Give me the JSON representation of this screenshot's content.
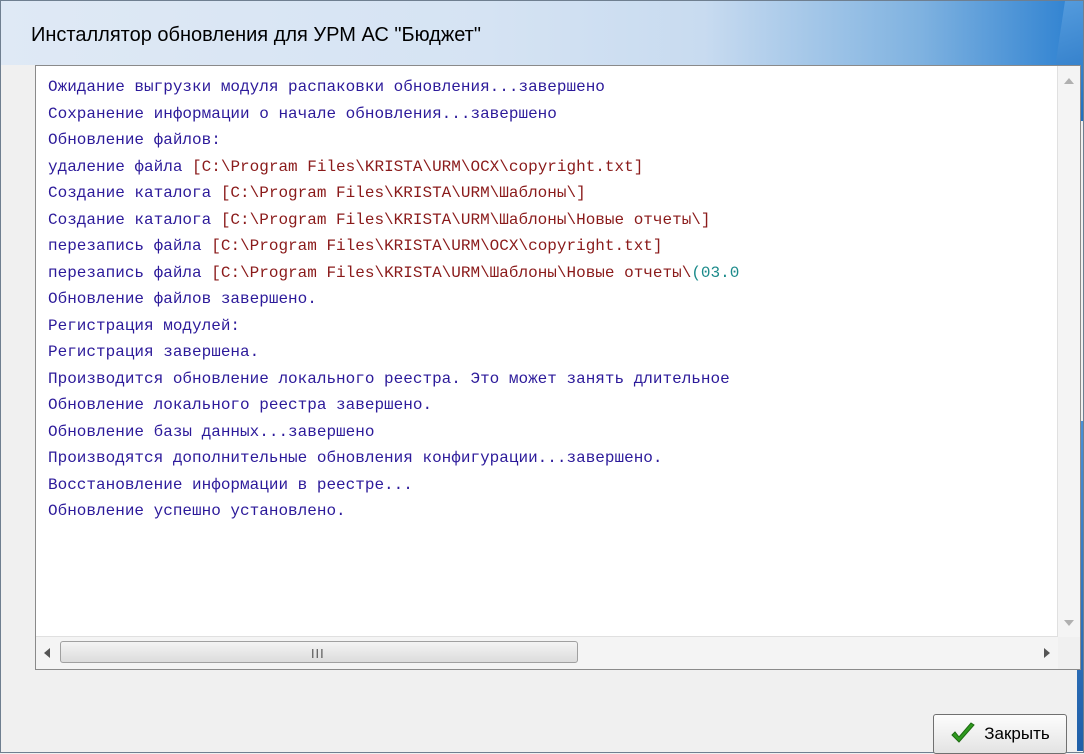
{
  "window": {
    "title": "Инсталлятор обновления для УРМ АС \"Бюджет\""
  },
  "log": {
    "lines": [
      [
        {
          "t": "Ожидание выгрузки модуля распаковки обновления...завершено",
          "c": "text"
        }
      ],
      [
        {
          "t": "Сохранение информации о начале обновления...завершено",
          "c": "text"
        }
      ],
      [
        {
          "t": "Обновление файлов:",
          "c": "text"
        }
      ],
      [
        {
          "t": "удаление файла ",
          "c": "text"
        },
        {
          "t": "[C:\\Program Files\\KRISTA\\URM\\OCX\\copyright.txt]",
          "c": "path"
        }
      ],
      [
        {
          "t": "Создание каталога ",
          "c": "text"
        },
        {
          "t": "[C:\\Program Files\\KRISTA\\URM\\Шаблоны\\]",
          "c": "path"
        }
      ],
      [
        {
          "t": "Создание каталога ",
          "c": "text"
        },
        {
          "t": "[C:\\Program Files\\KRISTA\\URM\\Шаблоны\\Новые отчеты\\]",
          "c": "path"
        }
      ],
      [
        {
          "t": "перезапись файла ",
          "c": "text"
        },
        {
          "t": "[C:\\Program Files\\KRISTA\\URM\\OCX\\copyright.txt]",
          "c": "path"
        }
      ],
      [
        {
          "t": "перезапись файла ",
          "c": "text"
        },
        {
          "t": "[C:\\Program Files\\KRISTA\\URM\\Шаблоны\\Новые отчеты\\",
          "c": "path"
        },
        {
          "t": "(03.0",
          "c": "teal"
        }
      ],
      [
        {
          "t": "Обновление файлов завершено.",
          "c": "text"
        }
      ],
      [
        {
          "t": "Регистрация модулей:",
          "c": "text"
        }
      ],
      [
        {
          "t": "Регистрация завершена.",
          "c": "text"
        }
      ],
      [
        {
          "t": "Производится обновление локального реестра. Это может занять длительное",
          "c": "text"
        }
      ],
      [
        {
          "t": "Обновление локального реестра завершено.",
          "c": "text"
        }
      ],
      [
        {
          "t": "Обновление базы данных...завершено",
          "c": "text"
        }
      ],
      [
        {
          "t": "Производятся дополнительные обновления конфигурации...завершено.",
          "c": "text"
        }
      ],
      [
        {
          "t": "Восстановление информации в реестре...",
          "c": "text"
        }
      ],
      [
        {
          "t": "Обновление успешно установлено.",
          "c": "text"
        }
      ]
    ]
  },
  "scrollbar": {
    "grip": "III"
  },
  "buttons": {
    "close_label": "Закрыть",
    "close_icon": "checkmark-icon"
  },
  "colors": {
    "text": "#2c1a9a",
    "path": "#8a1a1a",
    "teal": "#1a8a8a",
    "check": "#2e9a1e"
  }
}
